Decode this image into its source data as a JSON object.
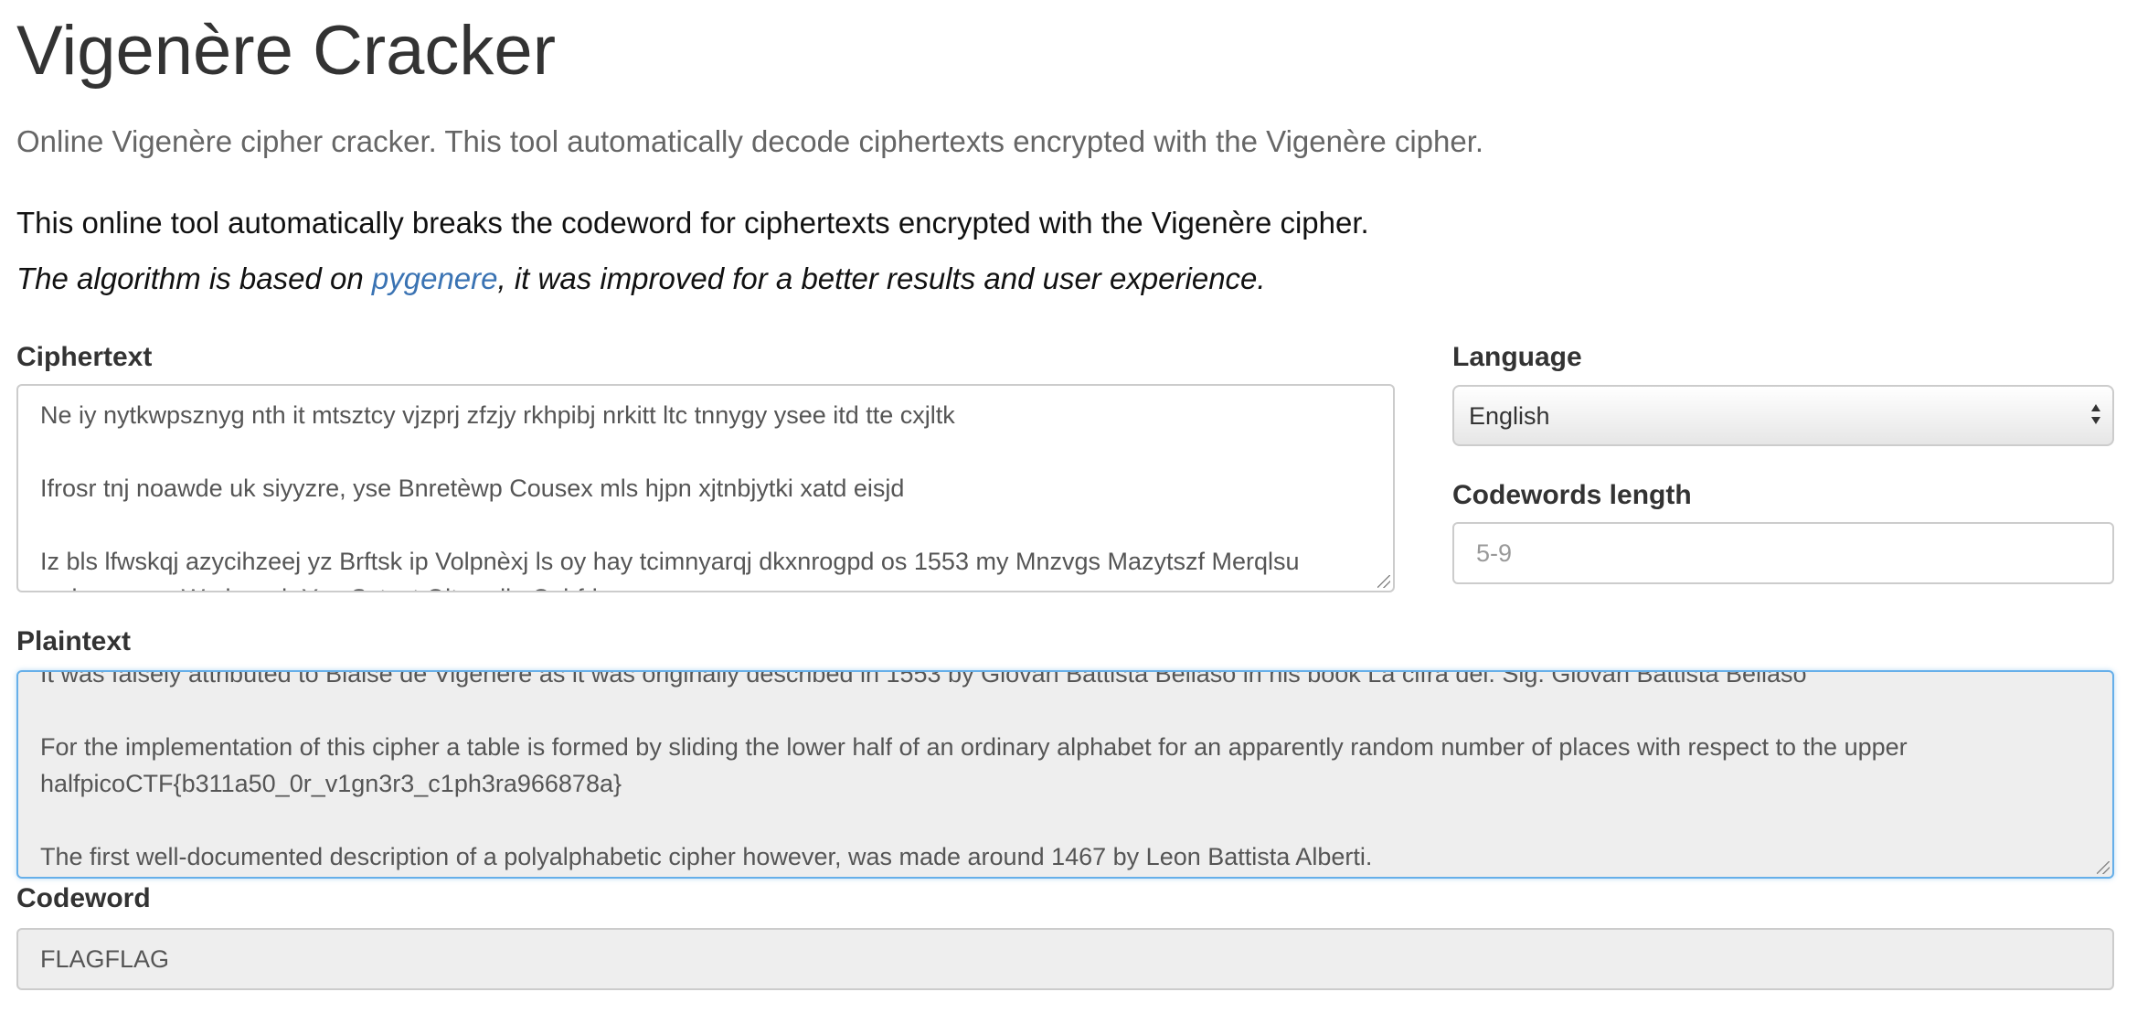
{
  "header": {
    "title": "Vigenère Cracker",
    "subtitle": "Online Vigenère cipher cracker. This tool automatically decode ciphertexts encrypted with the Vigenère cipher."
  },
  "intro": {
    "line1": "This online tool automatically breaks the codeword for ciphertexts encrypted with the Vigenère cipher.",
    "line2_prefix": "The algorithm is based on ",
    "line2_link": "pygenere",
    "line2_suffix": ", it was improved for a better results and user experience."
  },
  "ciphertext": {
    "label": "Ciphertext",
    "lines": [
      "Ne iy nytkwpsznyg nth it mtsztcy vjzprj zfzjy rkhpibj nrkitt ltc tnnygy ysee itd tte cxjltk",
      "",
      "Ifrosr tnj noawde uk siyyzre, yse Bnretèwp Cousex mls hjpn xjtnbjytki xatd eisjd",
      "",
      "Iz bls lfwskqj azycihzeej yz Brftsk ip Volpnèxj ls oy hay tcimnyarqj dkxnrogpd os 1553 my Mnzvgs Mazytszf Merqlsu",
      "uwbwpsapw Wvdvznylr Ypa Sytsut Oltzwcllu Cpbfdps"
    ]
  },
  "language": {
    "label": "Language",
    "selected": "English"
  },
  "codewords_length": {
    "label": "Codewords length",
    "placeholder": "5-9"
  },
  "plaintext": {
    "label": "Plaintext",
    "lines": [
      "It was falsely attributed to Blaise de Vigenère as it was originally described in 1553 by Giovan Battista Bellaso in his book La cifra del. Sig. Giovan Battista Bellaso",
      "",
      "For the implementation of this cipher a table is formed by sliding the lower half of an ordinary alphabet for an apparently random number of places with respect to the upper",
      "halfpicoCTF{b311a50_0r_v1gn3r3_c1ph3ra966878a}",
      "",
      "The first well-documented description of a polyalphabetic cipher however, was made around 1467 by Leon Battista Alberti."
    ]
  },
  "codeword": {
    "label": "Codeword",
    "value": "FLAGFLAG"
  },
  "colors": {
    "link": "#3a73b3",
    "focus_border": "#66afe9",
    "readonly_bg": "#eeeeee"
  }
}
